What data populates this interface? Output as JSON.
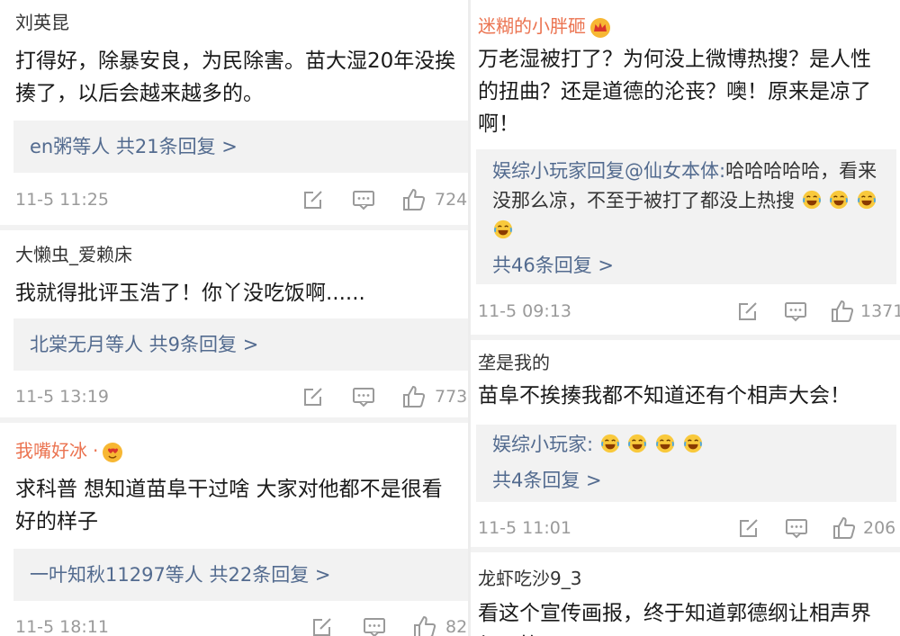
{
  "left_comments": [
    {
      "username": "刘英昆",
      "text": "打得好，除暴安良，为民除害。苗大湿20年没挨揍了，以后会越来越多的。",
      "reply_summary": "en粥等人  共21条回复 >",
      "time": "11-5 11:25",
      "likes": "724"
    },
    {
      "username": "大懒虫_爱赖床",
      "text": "我就得批评玉浩了！你丫没吃饭啊......",
      "reply_summary": "北棠无月等人  共9条回复 >",
      "time": "11-5 13:19",
      "likes": "773"
    },
    {
      "username": "我嘴好冰",
      "username_suffix": "·",
      "text": "求科普 想知道苗阜干过啥 大家对他都不是很看好的样子",
      "reply_summary": "一叶知秋11297等人  共22条回复 >",
      "time": "11-5 18:11",
      "likes": "82"
    }
  ],
  "right_comments": [
    {
      "username": "迷糊的小胖砸",
      "text": "万老湿被打了？为何没上微博热搜？是人性的扭曲？还是道德的沦丧？噢！原来是凉了啊！",
      "reply_name": "娱综小玩家回复@仙女本体:",
      "reply_text": "哈哈哈哈哈，看来没那么凉，不至于被打了都没上热搜",
      "reply_more": "共46条回复 >",
      "time": "11-5 09:13",
      "likes": "1371"
    },
    {
      "username": "垄是我的",
      "text": "苗阜不挨揍我都不知道还有个相声大会！",
      "reply_name": "娱综小玩家:",
      "reply_more": "共4条回复 >",
      "time": "11-5 11:01",
      "likes": "206"
    },
    {
      "username": "龙虾吃沙9_3",
      "text": "看这个宣传画报，终于知道郭德纲让相声界很可笑"
    }
  ],
  "colors": {
    "accent_orange": "#eb7350",
    "link_blue": "#536b8f",
    "meta_gray": "#9a9a9a",
    "reply_bg": "#f2f2f2"
  },
  "icons": {
    "crown": "crown-badge-icon",
    "heart_face": "heart-eyes-badge-icon",
    "edit": "edit-icon",
    "comment": "comment-icon",
    "like": "thumbs-up-icon",
    "emoji": "laugh-tears-emoji"
  }
}
